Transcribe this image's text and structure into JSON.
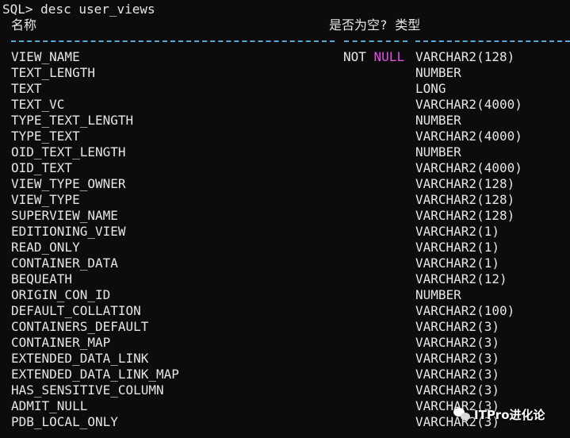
{
  "terminal": {
    "prompt": "SQL>",
    "command": "desc user_views",
    "headers": {
      "name": "名称",
      "nullable": "是否为空?",
      "type": "类型"
    },
    "rows": [
      {
        "name": "VIEW_NAME",
        "not": "NOT",
        "null": "NULL",
        "type": "VARCHAR2(128)"
      },
      {
        "name": "TEXT_LENGTH",
        "not": "",
        "null": "",
        "type": "NUMBER"
      },
      {
        "name": "TEXT",
        "not": "",
        "null": "",
        "type": "LONG"
      },
      {
        "name": "TEXT_VC",
        "not": "",
        "null": "",
        "type": "VARCHAR2(4000)"
      },
      {
        "name": "TYPE_TEXT_LENGTH",
        "not": "",
        "null": "",
        "type": "NUMBER"
      },
      {
        "name": "TYPE_TEXT",
        "not": "",
        "null": "",
        "type": "VARCHAR2(4000)"
      },
      {
        "name": "OID_TEXT_LENGTH",
        "not": "",
        "null": "",
        "type": "NUMBER"
      },
      {
        "name": "OID_TEXT",
        "not": "",
        "null": "",
        "type": "VARCHAR2(4000)"
      },
      {
        "name": "VIEW_TYPE_OWNER",
        "not": "",
        "null": "",
        "type": "VARCHAR2(128)"
      },
      {
        "name": "VIEW_TYPE",
        "not": "",
        "null": "",
        "type": "VARCHAR2(128)"
      },
      {
        "name": "SUPERVIEW_NAME",
        "not": "",
        "null": "",
        "type": "VARCHAR2(128)"
      },
      {
        "name": "EDITIONING_VIEW",
        "not": "",
        "null": "",
        "type": "VARCHAR2(1)"
      },
      {
        "name": "READ_ONLY",
        "not": "",
        "null": "",
        "type": "VARCHAR2(1)"
      },
      {
        "name": "CONTAINER_DATA",
        "not": "",
        "null": "",
        "type": "VARCHAR2(1)"
      },
      {
        "name": "BEQUEATH",
        "not": "",
        "null": "",
        "type": "VARCHAR2(12)"
      },
      {
        "name": "ORIGIN_CON_ID",
        "not": "",
        "null": "",
        "type": "NUMBER"
      },
      {
        "name": "DEFAULT_COLLATION",
        "not": "",
        "null": "",
        "type": "VARCHAR2(100)"
      },
      {
        "name": "CONTAINERS_DEFAULT",
        "not": "",
        "null": "",
        "type": "VARCHAR2(3)"
      },
      {
        "name": "CONTAINER_MAP",
        "not": "",
        "null": "",
        "type": "VARCHAR2(3)"
      },
      {
        "name": "EXTENDED_DATA_LINK",
        "not": "",
        "null": "",
        "type": "VARCHAR2(3)"
      },
      {
        "name": "EXTENDED_DATA_LINK_MAP",
        "not": "",
        "null": "",
        "type": "VARCHAR2(3)"
      },
      {
        "name": "HAS_SENSITIVE_COLUMN",
        "not": "",
        "null": "",
        "type": "VARCHAR2(3)"
      },
      {
        "name": "ADMIT_NULL",
        "not": "",
        "null": "",
        "type": "VARCHAR2(3)"
      },
      {
        "name": "PDB_LOCAL_ONLY",
        "not": "",
        "null": "",
        "type": "VARCHAR2(3)"
      }
    ]
  },
  "watermark": {
    "text": "ITPro进化论",
    "icon": "wechat-icon"
  },
  "colors": {
    "background": "#0c0c0c",
    "text": "#e6e6e6",
    "null_highlight": "#e14de6",
    "separator": "#5aa8d6"
  }
}
